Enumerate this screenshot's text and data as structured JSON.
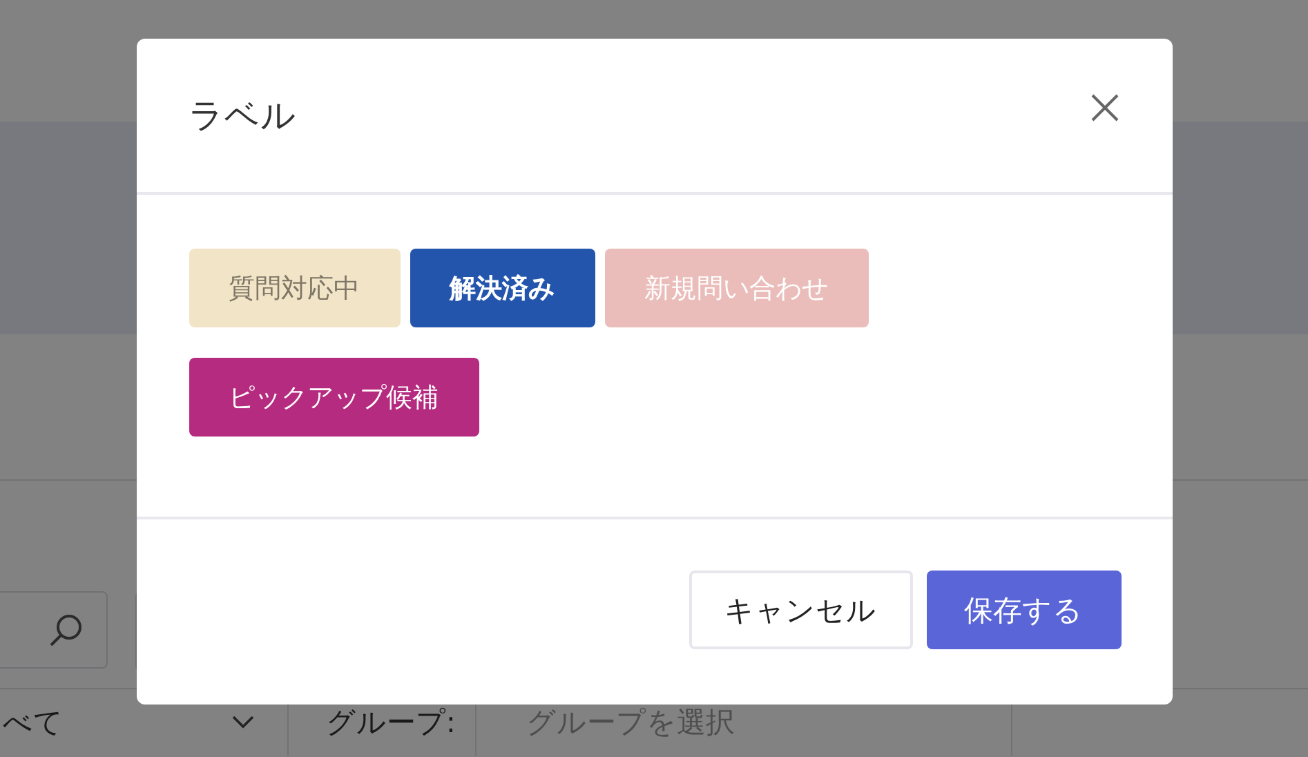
{
  "filter": {
    "value": "べて"
  },
  "group_filter": {
    "label": "グループ:",
    "placeholder": "グループを選択"
  },
  "dialog": {
    "title": "ラベル",
    "labels": [
      {
        "text": "質問対応中",
        "color": "#f2e4c6",
        "selected": false
      },
      {
        "text": "解決済み",
        "color": "#2455ac",
        "selected": true
      },
      {
        "text": "新規問い合わせ",
        "color": "#eabdba",
        "selected": false
      },
      {
        "text": "ピックアップ候補",
        "color": "#b52b7f",
        "selected": false
      }
    ],
    "buttons": [
      {
        "label": "キャンセル",
        "kind": "secondary"
      },
      {
        "label": "保存する",
        "kind": "primary"
      }
    ]
  }
}
